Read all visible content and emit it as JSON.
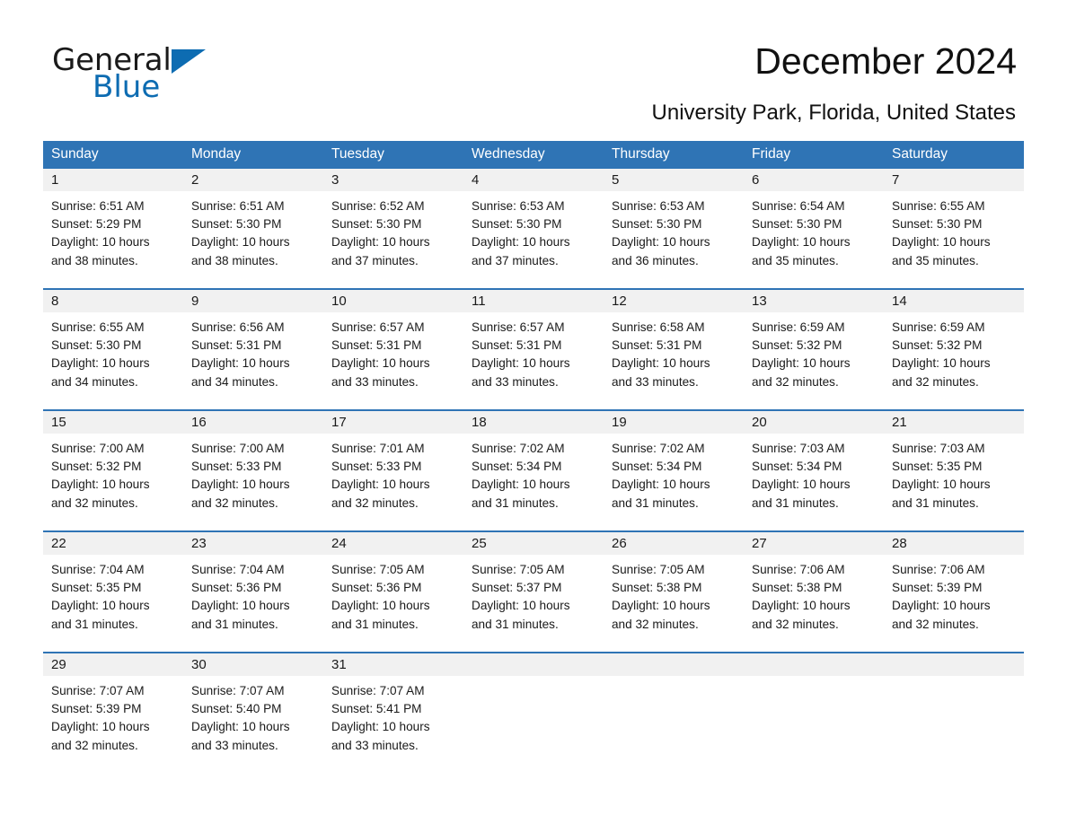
{
  "brand": {
    "word1": "General",
    "word2": "Blue",
    "triangle_color": "#0d6cb2",
    "icon": "triangle-logo-icon"
  },
  "header": {
    "title": "December 2024",
    "subtitle": "University Park, Florida, United States",
    "accent_color": "#2f74b5",
    "daynum_band_color": "#f1f1f1"
  },
  "calendar": {
    "weekdays": [
      "Sunday",
      "Monday",
      "Tuesday",
      "Wednesday",
      "Thursday",
      "Friday",
      "Saturday"
    ],
    "weeks": [
      [
        {
          "day": "1",
          "sunrise": "Sunrise: 6:51 AM",
          "sunset": "Sunset: 5:29 PM",
          "daylight1": "Daylight: 10 hours",
          "daylight2": "and 38 minutes."
        },
        {
          "day": "2",
          "sunrise": "Sunrise: 6:51 AM",
          "sunset": "Sunset: 5:30 PM",
          "daylight1": "Daylight: 10 hours",
          "daylight2": "and 38 minutes."
        },
        {
          "day": "3",
          "sunrise": "Sunrise: 6:52 AM",
          "sunset": "Sunset: 5:30 PM",
          "daylight1": "Daylight: 10 hours",
          "daylight2": "and 37 minutes."
        },
        {
          "day": "4",
          "sunrise": "Sunrise: 6:53 AM",
          "sunset": "Sunset: 5:30 PM",
          "daylight1": "Daylight: 10 hours",
          "daylight2": "and 37 minutes."
        },
        {
          "day": "5",
          "sunrise": "Sunrise: 6:53 AM",
          "sunset": "Sunset: 5:30 PM",
          "daylight1": "Daylight: 10 hours",
          "daylight2": "and 36 minutes."
        },
        {
          "day": "6",
          "sunrise": "Sunrise: 6:54 AM",
          "sunset": "Sunset: 5:30 PM",
          "daylight1": "Daylight: 10 hours",
          "daylight2": "and 35 minutes."
        },
        {
          "day": "7",
          "sunrise": "Sunrise: 6:55 AM",
          "sunset": "Sunset: 5:30 PM",
          "daylight1": "Daylight: 10 hours",
          "daylight2": "and 35 minutes."
        }
      ],
      [
        {
          "day": "8",
          "sunrise": "Sunrise: 6:55 AM",
          "sunset": "Sunset: 5:30 PM",
          "daylight1": "Daylight: 10 hours",
          "daylight2": "and 34 minutes."
        },
        {
          "day": "9",
          "sunrise": "Sunrise: 6:56 AM",
          "sunset": "Sunset: 5:31 PM",
          "daylight1": "Daylight: 10 hours",
          "daylight2": "and 34 minutes."
        },
        {
          "day": "10",
          "sunrise": "Sunrise: 6:57 AM",
          "sunset": "Sunset: 5:31 PM",
          "daylight1": "Daylight: 10 hours",
          "daylight2": "and 33 minutes."
        },
        {
          "day": "11",
          "sunrise": "Sunrise: 6:57 AM",
          "sunset": "Sunset: 5:31 PM",
          "daylight1": "Daylight: 10 hours",
          "daylight2": "and 33 minutes."
        },
        {
          "day": "12",
          "sunrise": "Sunrise: 6:58 AM",
          "sunset": "Sunset: 5:31 PM",
          "daylight1": "Daylight: 10 hours",
          "daylight2": "and 33 minutes."
        },
        {
          "day": "13",
          "sunrise": "Sunrise: 6:59 AM",
          "sunset": "Sunset: 5:32 PM",
          "daylight1": "Daylight: 10 hours",
          "daylight2": "and 32 minutes."
        },
        {
          "day": "14",
          "sunrise": "Sunrise: 6:59 AM",
          "sunset": "Sunset: 5:32 PM",
          "daylight1": "Daylight: 10 hours",
          "daylight2": "and 32 minutes."
        }
      ],
      [
        {
          "day": "15",
          "sunrise": "Sunrise: 7:00 AM",
          "sunset": "Sunset: 5:32 PM",
          "daylight1": "Daylight: 10 hours",
          "daylight2": "and 32 minutes."
        },
        {
          "day": "16",
          "sunrise": "Sunrise: 7:00 AM",
          "sunset": "Sunset: 5:33 PM",
          "daylight1": "Daylight: 10 hours",
          "daylight2": "and 32 minutes."
        },
        {
          "day": "17",
          "sunrise": "Sunrise: 7:01 AM",
          "sunset": "Sunset: 5:33 PM",
          "daylight1": "Daylight: 10 hours",
          "daylight2": "and 32 minutes."
        },
        {
          "day": "18",
          "sunrise": "Sunrise: 7:02 AM",
          "sunset": "Sunset: 5:34 PM",
          "daylight1": "Daylight: 10 hours",
          "daylight2": "and 31 minutes."
        },
        {
          "day": "19",
          "sunrise": "Sunrise: 7:02 AM",
          "sunset": "Sunset: 5:34 PM",
          "daylight1": "Daylight: 10 hours",
          "daylight2": "and 31 minutes."
        },
        {
          "day": "20",
          "sunrise": "Sunrise: 7:03 AM",
          "sunset": "Sunset: 5:34 PM",
          "daylight1": "Daylight: 10 hours",
          "daylight2": "and 31 minutes."
        },
        {
          "day": "21",
          "sunrise": "Sunrise: 7:03 AM",
          "sunset": "Sunset: 5:35 PM",
          "daylight1": "Daylight: 10 hours",
          "daylight2": "and 31 minutes."
        }
      ],
      [
        {
          "day": "22",
          "sunrise": "Sunrise: 7:04 AM",
          "sunset": "Sunset: 5:35 PM",
          "daylight1": "Daylight: 10 hours",
          "daylight2": "and 31 minutes."
        },
        {
          "day": "23",
          "sunrise": "Sunrise: 7:04 AM",
          "sunset": "Sunset: 5:36 PM",
          "daylight1": "Daylight: 10 hours",
          "daylight2": "and 31 minutes."
        },
        {
          "day": "24",
          "sunrise": "Sunrise: 7:05 AM",
          "sunset": "Sunset: 5:36 PM",
          "daylight1": "Daylight: 10 hours",
          "daylight2": "and 31 minutes."
        },
        {
          "day": "25",
          "sunrise": "Sunrise: 7:05 AM",
          "sunset": "Sunset: 5:37 PM",
          "daylight1": "Daylight: 10 hours",
          "daylight2": "and 31 minutes."
        },
        {
          "day": "26",
          "sunrise": "Sunrise: 7:05 AM",
          "sunset": "Sunset: 5:38 PM",
          "daylight1": "Daylight: 10 hours",
          "daylight2": "and 32 minutes."
        },
        {
          "day": "27",
          "sunrise": "Sunrise: 7:06 AM",
          "sunset": "Sunset: 5:38 PM",
          "daylight1": "Daylight: 10 hours",
          "daylight2": "and 32 minutes."
        },
        {
          "day": "28",
          "sunrise": "Sunrise: 7:06 AM",
          "sunset": "Sunset: 5:39 PM",
          "daylight1": "Daylight: 10 hours",
          "daylight2": "and 32 minutes."
        }
      ],
      [
        {
          "day": "29",
          "sunrise": "Sunrise: 7:07 AM",
          "sunset": "Sunset: 5:39 PM",
          "daylight1": "Daylight: 10 hours",
          "daylight2": "and 32 minutes."
        },
        {
          "day": "30",
          "sunrise": "Sunrise: 7:07 AM",
          "sunset": "Sunset: 5:40 PM",
          "daylight1": "Daylight: 10 hours",
          "daylight2": "and 33 minutes."
        },
        {
          "day": "31",
          "sunrise": "Sunrise: 7:07 AM",
          "sunset": "Sunset: 5:41 PM",
          "daylight1": "Daylight: 10 hours",
          "daylight2": "and 33 minutes."
        },
        {
          "day": "",
          "sunrise": "",
          "sunset": "",
          "daylight1": "",
          "daylight2": ""
        },
        {
          "day": "",
          "sunrise": "",
          "sunset": "",
          "daylight1": "",
          "daylight2": ""
        },
        {
          "day": "",
          "sunrise": "",
          "sunset": "",
          "daylight1": "",
          "daylight2": ""
        },
        {
          "day": "",
          "sunrise": "",
          "sunset": "",
          "daylight1": "",
          "daylight2": ""
        }
      ]
    ]
  }
}
